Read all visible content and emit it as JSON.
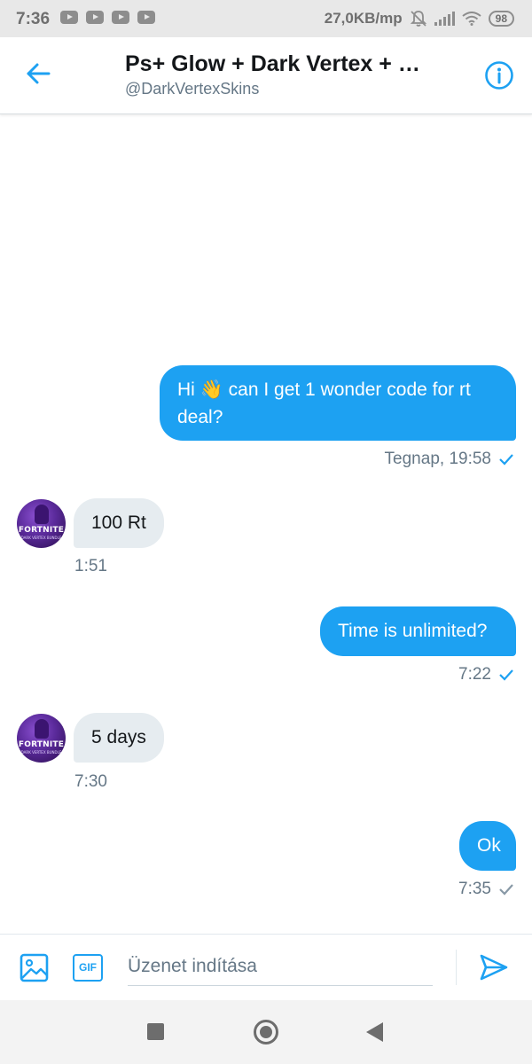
{
  "status_bar": {
    "time": "7:36",
    "notification_icons": [
      "youtube-icon",
      "youtube-icon",
      "youtube-icon",
      "youtube-icon"
    ],
    "network_speed": "27,0KB/mp",
    "battery": "98"
  },
  "header": {
    "title": "Ps+ Glow + Dark Vertex + …",
    "handle": "@DarkVertexSkins",
    "back_icon": "arrow-left-icon",
    "info_icon": "info-icon"
  },
  "messages": [
    {
      "direction": "out",
      "text": "Hi 👋 can I get 1 wonder code for rt deal?",
      "time": "Tegnap, 19:58",
      "status": "read"
    },
    {
      "direction": "in",
      "text": "100 Rt",
      "time": "1:51"
    },
    {
      "direction": "out",
      "text": "Time is unlimited?",
      "time": "7:22",
      "status": "read"
    },
    {
      "direction": "in",
      "text": "5 days",
      "time": "7:30"
    },
    {
      "direction": "out",
      "text": "Ok",
      "time": "7:35",
      "status": "sent"
    }
  ],
  "avatar": {
    "logo_text": "FORTNITE",
    "subtitle": "DARK VERTEX BUNDLE"
  },
  "composer": {
    "placeholder": "Üzenet indítása",
    "media_icon": "image-icon",
    "gif_label": "GIF",
    "send_icon": "send-icon"
  },
  "colors": {
    "accent": "#1da1f2",
    "incoming_bubble": "#e6ecf0",
    "secondary_text": "#657786"
  }
}
